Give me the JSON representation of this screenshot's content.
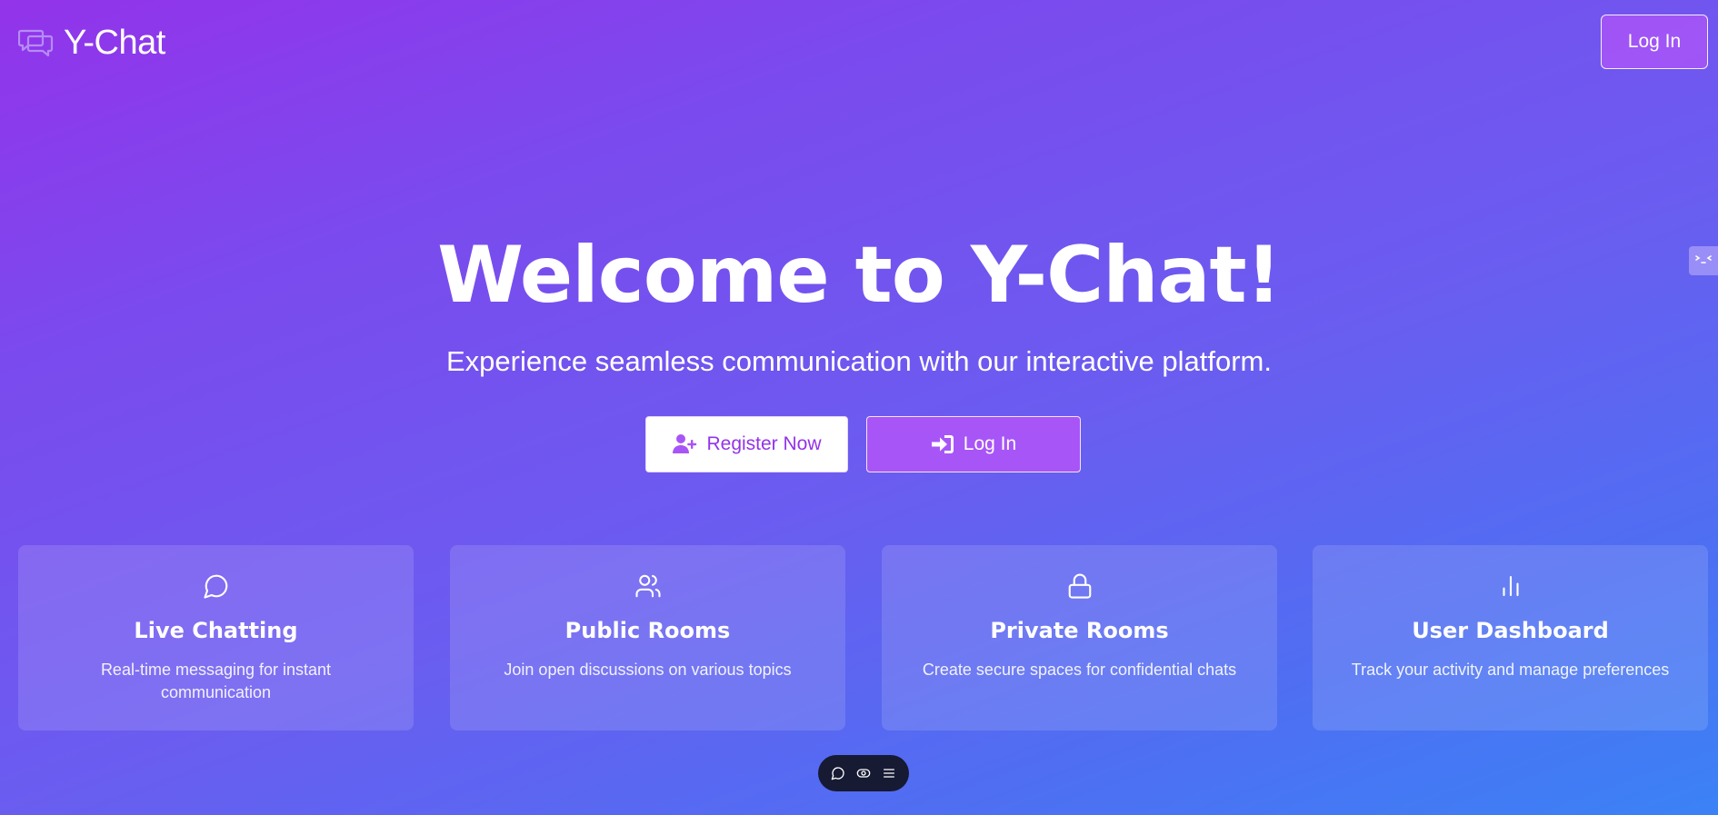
{
  "header": {
    "brand_name": "Y-Chat",
    "brand_icon": "chat-bubbles-icon",
    "login_label": "Log In"
  },
  "hero": {
    "title": "Welcome to Y-Chat!",
    "subtitle": "Experience seamless communication with our interactive platform.",
    "register_label": "Register Now",
    "register_icon": "user-plus-icon",
    "login_label": "Log In",
    "login_icon": "sign-in-icon"
  },
  "features": [
    {
      "icon": "message-circle-icon",
      "title": "Live Chatting",
      "description": "Real-time messaging for instant communication"
    },
    {
      "icon": "users-icon",
      "title": "Public Rooms",
      "description": "Join open discussions on various topics"
    },
    {
      "icon": "lock-icon",
      "title": "Private Rooms",
      "description": "Create secure spaces for confidential chats"
    },
    {
      "icon": "bar-chart-icon",
      "title": "User Dashboard",
      "description": "Track your activity and manage preferences"
    }
  ],
  "dock": {
    "icons": [
      "chat-icon",
      "eye-icon",
      "menu-icon"
    ]
  },
  "colors": {
    "gradient_start": "#9333ea",
    "gradient_end": "#3b82f6",
    "accent": "#a855f7",
    "dock_bg": "#161a33"
  }
}
